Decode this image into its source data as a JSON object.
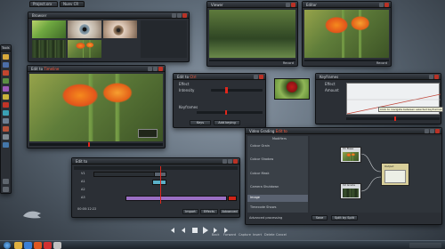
{
  "tabs": {
    "project": "Project.orx",
    "clips": "Nuev CR"
  },
  "browser": {
    "title": "Browser"
  },
  "viewer_top": {
    "title": "Viewer",
    "label": "Record"
  },
  "viewer_right": {
    "title": "Editor",
    "label": "Record"
  },
  "left_toolbar": {
    "title": "Tools"
  },
  "edit_viewer": {
    "title": "Edit to",
    "title_hi": "Timeline",
    "timecode": "00:00:00:00"
  },
  "effect_panel": {
    "title": "Edit to",
    "title_hi": "Ctrl",
    "section1": "Effect",
    "row1": "Intensity",
    "section2": "Keyframes",
    "btn_a": "Keys",
    "btn_b": "Add keying"
  },
  "keyframe_panel": {
    "title": "Keyframes",
    "param1": "Effect",
    "param2": "Amount",
    "tooltip": "Click to navigate between selected keyframes"
  },
  "timeline": {
    "title": "Edit to",
    "tracks": [
      "V1",
      "A1",
      "A2",
      "A3"
    ],
    "timecode": "00:00:12:22",
    "btn_import": "Import",
    "btn_effects": "Effects",
    "btn_advanced": "Advanced"
  },
  "node_editor": {
    "title": "Video Grading",
    "title_hi": "Edit to",
    "header": "Modifiers",
    "list": [
      "Colour Grain",
      "Colour Shadow",
      "Colour Mask",
      "Camera Shutdown",
      "Image",
      "Timecode Shows"
    ],
    "nodes": {
      "a": "V1 Base",
      "b": "V2 Grade",
      "c": "Output"
    },
    "footer_label": "Advanced processing",
    "footer_btn1": "Save",
    "footer_btn2": "Split by Split"
  },
  "player_controls": [
    "Back",
    "Forward",
    "Capture",
    "Insert",
    "Delete",
    "Cancel"
  ],
  "colors": {
    "accent": "#e85a2a",
    "playhead": "#e0271c",
    "window": "#2b2f35"
  }
}
